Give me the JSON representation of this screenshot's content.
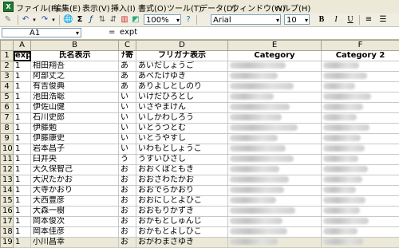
{
  "menu": [
    "ファイル(F)",
    "編集(E)",
    "表示(V)",
    "挿入(I)",
    "書式(O)",
    "ツール(T)",
    "データ(D)",
    "ウィンドウ(W)",
    "ヘルプ(H)"
  ],
  "toolbar": {
    "zoom": "100%",
    "font": "Arial",
    "font_size": "10",
    "bold": "B",
    "italic": "I",
    "underline": "U",
    "sigma": "Σ"
  },
  "formula_bar": {
    "cell_ref": "A1",
    "equals": "=",
    "content": "expt"
  },
  "columns": [
    "A",
    "B",
    "C",
    "D",
    "E",
    "F"
  ],
  "header_row": [
    "expt",
    "氏名表示",
    "ﾅ寄",
    "フリガナ表示",
    "Category",
    "Category 2"
  ],
  "rows": [
    {
      "n": "2",
      "a": "1",
      "b": "相田翔吾",
      "c": "あ",
      "d": "あいだしょうご"
    },
    {
      "n": "3",
      "a": "1",
      "b": "阿部丈之",
      "c": "あ",
      "d": "あべたけゆき"
    },
    {
      "n": "4",
      "a": "1",
      "b": "有吉俊典",
      "c": "あ",
      "d": "ありよしとしのり"
    },
    {
      "n": "5",
      "a": "1",
      "b": "池田浩聡",
      "c": "い",
      "d": "いけだひろとし"
    },
    {
      "n": "6",
      "a": "1",
      "b": "伊佐山健",
      "c": "い",
      "d": "いさやまけん"
    },
    {
      "n": "7",
      "a": "1",
      "b": "石川史郎",
      "c": "い",
      "d": "いしかわしろう"
    },
    {
      "n": "8",
      "a": "1",
      "b": "伊藤勉",
      "c": "い",
      "d": "いとうつとむ"
    },
    {
      "n": "9",
      "a": "1",
      "b": "伊藤康史",
      "c": "い",
      "d": "いとうやすし"
    },
    {
      "n": "10",
      "a": "1",
      "b": "岩本昌子",
      "c": "い",
      "d": "いわもとしょうこ"
    },
    {
      "n": "11",
      "a": "1",
      "b": "臼井央",
      "c": "う",
      "d": "うすいひさし"
    },
    {
      "n": "12",
      "a": "1",
      "b": "大久保智己",
      "c": "お",
      "d": "おおくぼともき"
    },
    {
      "n": "13",
      "a": "1",
      "b": "大沢たかお",
      "c": "お",
      "d": "おおさわたかお"
    },
    {
      "n": "14",
      "a": "1",
      "b": "大寺かおり",
      "c": "お",
      "d": "おおでらかおり"
    },
    {
      "n": "15",
      "a": "1",
      "b": "大西豊彦",
      "c": "お",
      "d": "おおにしとよひこ"
    },
    {
      "n": "16",
      "a": "1",
      "b": "大森一樹",
      "c": "お",
      "d": "おおもりかずき"
    },
    {
      "n": "17",
      "a": "1",
      "b": "岡本俊次",
      "c": "お",
      "d": "おかもとしゅんじ"
    },
    {
      "n": "18",
      "a": "1",
      "b": "岡本佳彦",
      "c": "お",
      "d": "おかもとよしひこ"
    },
    {
      "n": "19",
      "a": "1",
      "b": "小川昌幸",
      "c": "お",
      "d": "おがわまさゆき"
    }
  ]
}
